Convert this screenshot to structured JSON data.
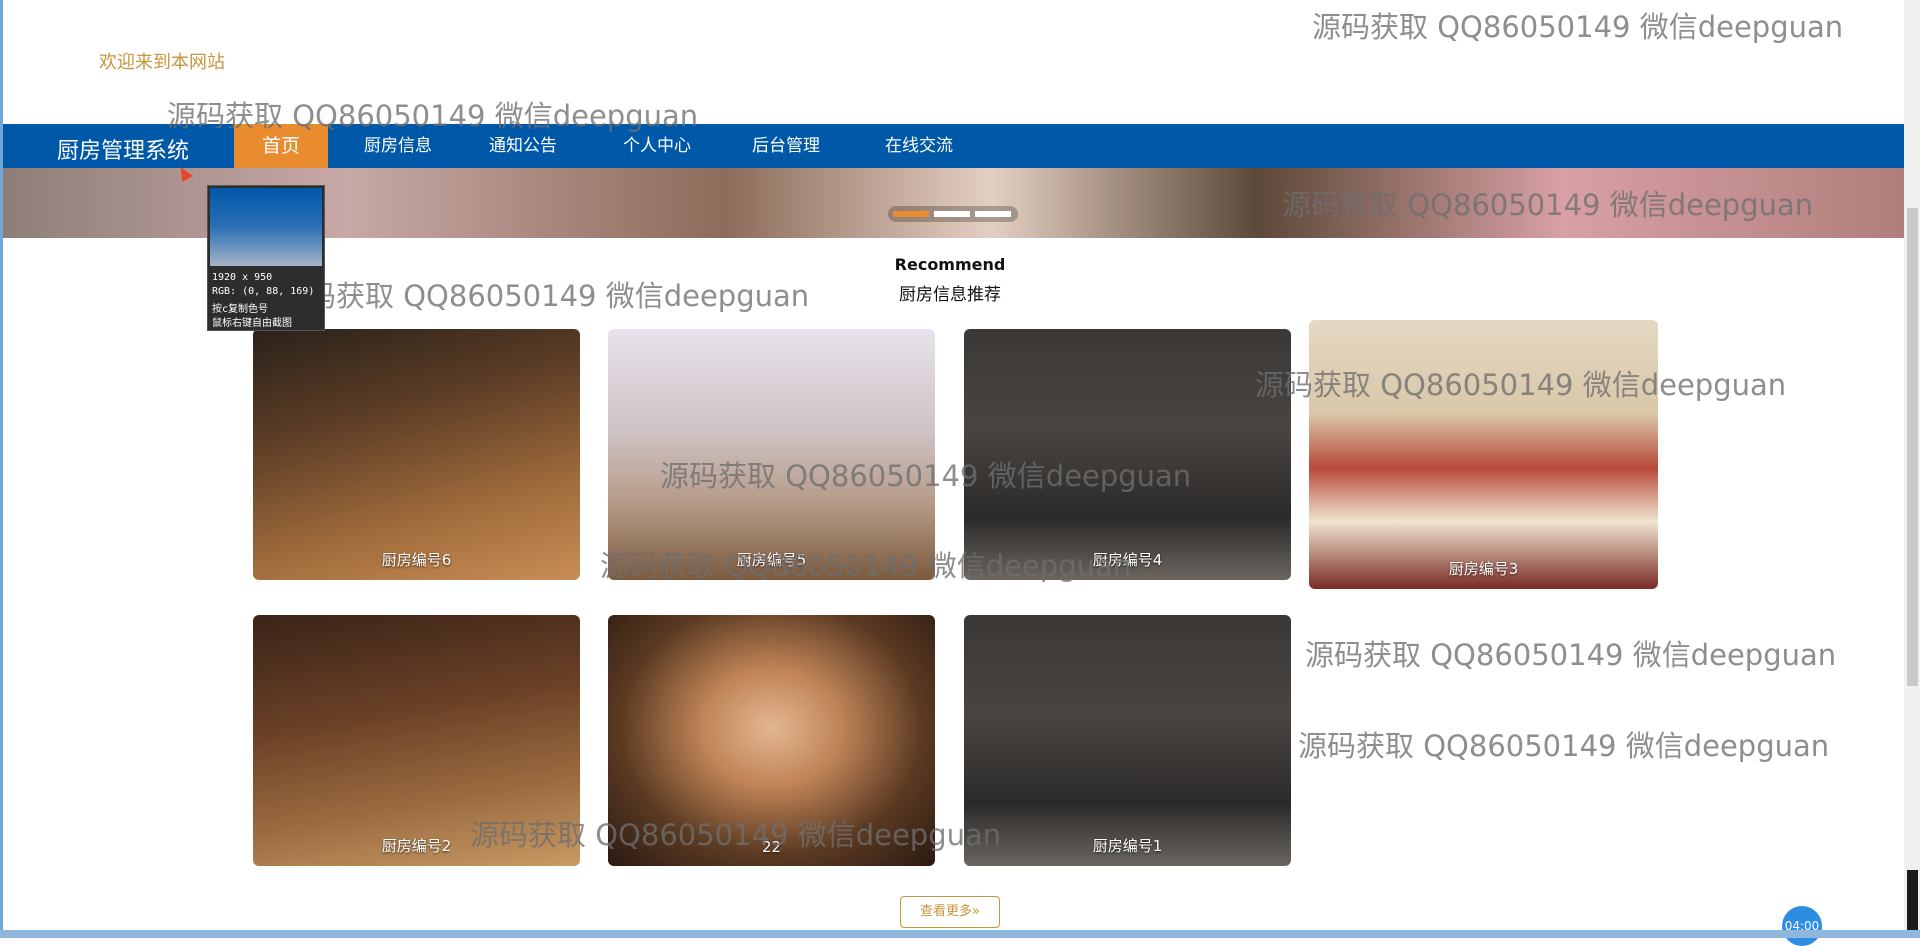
{
  "header": {
    "welcome": "欢迎来到本网站"
  },
  "nav": {
    "brand": "厨房管理系统",
    "items": [
      {
        "label": "首页",
        "active": true
      },
      {
        "label": "厨房信息"
      },
      {
        "label": "通知公告"
      },
      {
        "label": "个人中心"
      },
      {
        "label": "后台管理"
      },
      {
        "label": "在线交流"
      }
    ]
  },
  "banner": {
    "dots": 3,
    "active_dot": 1
  },
  "section": {
    "title": "Recommend",
    "subtitle": "厨房信息推荐"
  },
  "cards": [
    {
      "label": "厨房编号6",
      "image": "restaurant-wood-interior"
    },
    {
      "label": "厨房编号5",
      "image": "bright-dining-hall"
    },
    {
      "label": "厨房编号4",
      "image": "dark-restaurant-interior"
    },
    {
      "label": "厨房编号3",
      "image": "round-banquet-table"
    },
    {
      "label": "厨房编号2",
      "image": "warm-restaurant-interior"
    },
    {
      "label": "22",
      "image": "woman-portrait"
    },
    {
      "label": "厨房编号1",
      "image": "dark-restaurant-interior"
    }
  ],
  "more_button": "查看更多»",
  "timer": "04:00",
  "watermark": "源码获取 QQ86050149 微信deepguan",
  "screenshot_tool": {
    "size": "1920 x 950",
    "rgb": "RGB: (0, 88, 169)",
    "hint1": "按c复制色号",
    "hint2": "鼠标右键自由截图"
  },
  "colors": {
    "nav": "#0058a9",
    "accent": "#e98b2f",
    "welcome": "#c8963c"
  }
}
